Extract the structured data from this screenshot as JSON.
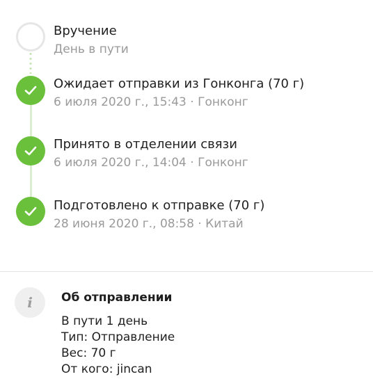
{
  "timeline": {
    "events": [
      {
        "title": "Вручение",
        "subtitle": "День в пути",
        "status": "pending"
      },
      {
        "title": "Ожидает отправки из Гонконга (70 г)",
        "subtitle": "6 июля 2020 г., 15:43 · Гонконг",
        "status": "done"
      },
      {
        "title": "Принято в отделении связи",
        "subtitle": "6 июля 2020 г., 14:04 · Гонконг",
        "status": "done"
      },
      {
        "title": "Подготовлено к отправке (70 г)",
        "subtitle": "28 июня 2020 г., 08:58 · Китай",
        "status": "done"
      }
    ]
  },
  "shipment_info": {
    "icon": "info-icon",
    "heading": "Об отправлении",
    "lines": [
      "В пути 1 день",
      "Тип: Отправление",
      "Вес: 70 г",
      "От кого: jincan"
    ]
  },
  "colors": {
    "accent_green": "#6abf3b",
    "track": "#dbefd0",
    "muted_text": "#9a9a9a"
  }
}
